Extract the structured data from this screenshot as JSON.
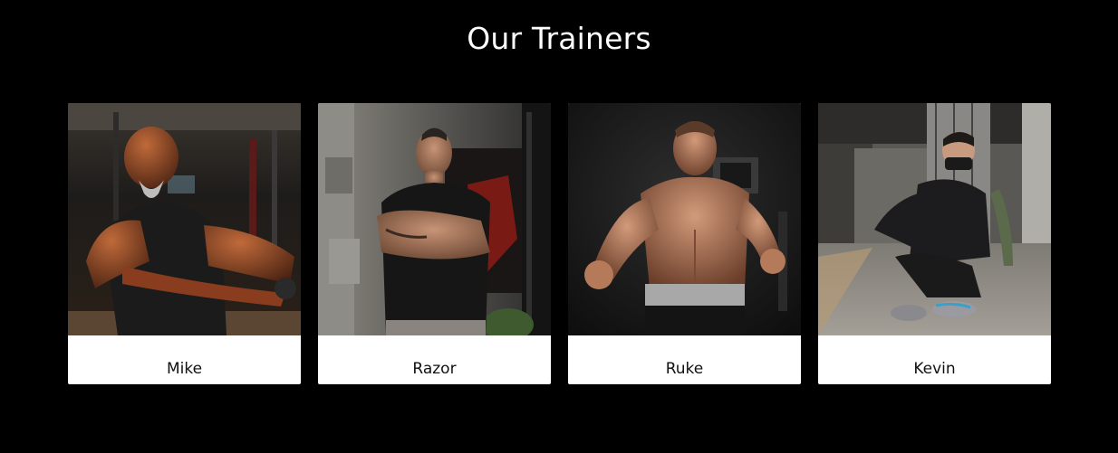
{
  "section": {
    "title": "Our Trainers"
  },
  "trainers": [
    {
      "name": "Mike"
    },
    {
      "name": "Razor"
    },
    {
      "name": "Ruke"
    },
    {
      "name": "Kevin"
    }
  ]
}
